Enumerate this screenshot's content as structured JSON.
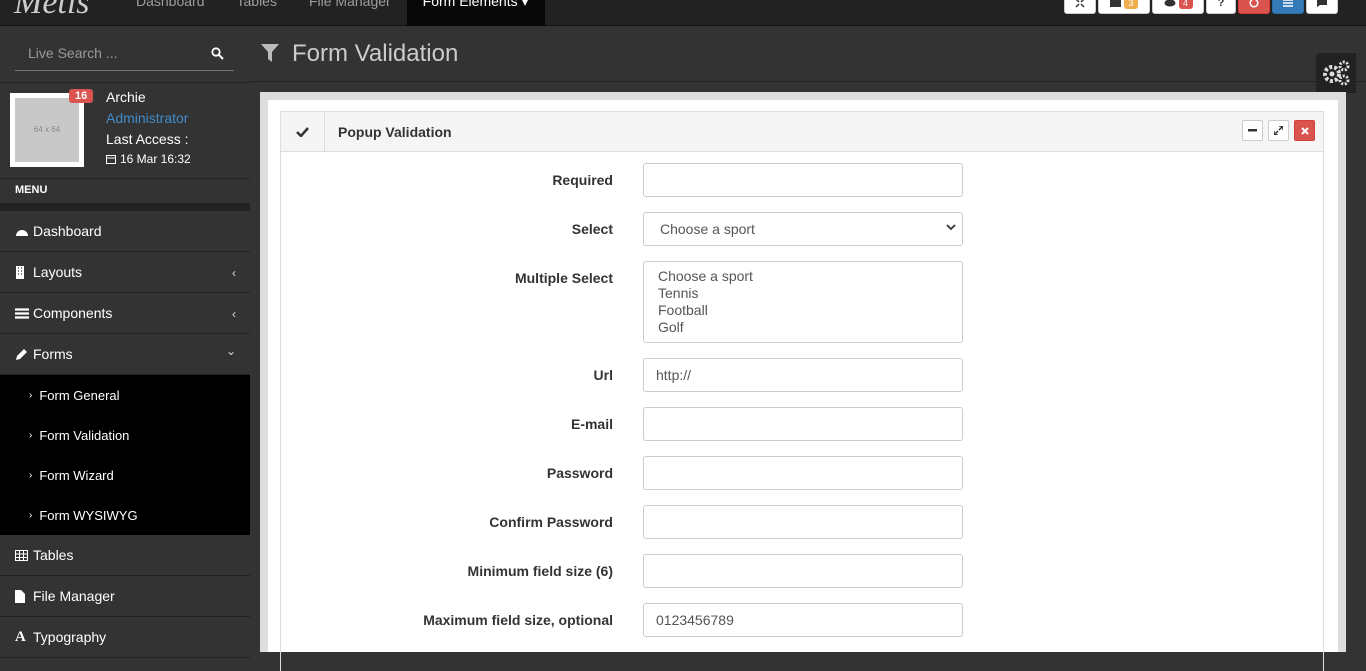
{
  "topbar": {
    "logo": "Metis",
    "nav": [
      "Dashboard",
      "Tables",
      "File Manager",
      "Form Elements ▾"
    ],
    "active_nav": 3,
    "buttons": [
      {
        "name": "fullscreen",
        "icon": "expand-icon"
      },
      {
        "name": "messages",
        "icon": "envelope-icon",
        "badge": "3",
        "badge_color": "#f0ad4e"
      },
      {
        "name": "comments",
        "icon": "comments-icon",
        "badge": "4",
        "badge_color": "#d9534f"
      },
      {
        "name": "help",
        "icon": "question-icon"
      },
      {
        "name": "power",
        "icon": "power-icon"
      },
      {
        "name": "toggle-menu",
        "icon": "bars-icon"
      },
      {
        "name": "toggle-right",
        "icon": "comment-icon"
      }
    ]
  },
  "sidebar": {
    "search_placeholder": "Live Search ...",
    "user": {
      "badge": "16",
      "avatar_text": "64 x 64",
      "name": "Archie",
      "role": "Administrator",
      "last_access_label": "Last Access :",
      "last_access": "16 Mar 16:32"
    },
    "menu_header": "MENU",
    "items": [
      {
        "label": "Dashboard",
        "icon": "dashboard-icon",
        "arrow": ""
      },
      {
        "label": "Layouts",
        "icon": "building-icon",
        "arrow": "‹"
      },
      {
        "label": "Components",
        "icon": "tasks-icon",
        "arrow": "‹"
      },
      {
        "label": "Forms",
        "icon": "pencil-icon",
        "arrow": "⌄"
      }
    ],
    "subitems": [
      "Form General",
      "Form Validation",
      "Form Wizard",
      "Form WYSIWYG"
    ],
    "items_after": [
      {
        "label": "Tables",
        "icon": "table-icon"
      },
      {
        "label": "File Manager",
        "icon": "file-icon"
      },
      {
        "label": "Typography",
        "icon": "font-icon"
      }
    ]
  },
  "main": {
    "page_title": "Form Validation",
    "box_title": "Popup Validation",
    "form": {
      "required_label": "Required",
      "required_value": "",
      "select_label": "Select",
      "select_value": "Choose a sport",
      "multiple_label": "Multiple Select",
      "multiple_options": [
        "Choose a sport",
        "Tennis",
        "Football",
        "Golf"
      ],
      "url_label": "Url",
      "url_value": "http://",
      "email_label": "E-mail",
      "email_value": "",
      "password_label": "Password",
      "password_value": "",
      "confirm_label": "Confirm Password",
      "confirm_value": "",
      "min_label": "Minimum field size (6)",
      "min_value": "",
      "max_label": "Maximum field size, optional",
      "max_value": "0123456789"
    }
  }
}
